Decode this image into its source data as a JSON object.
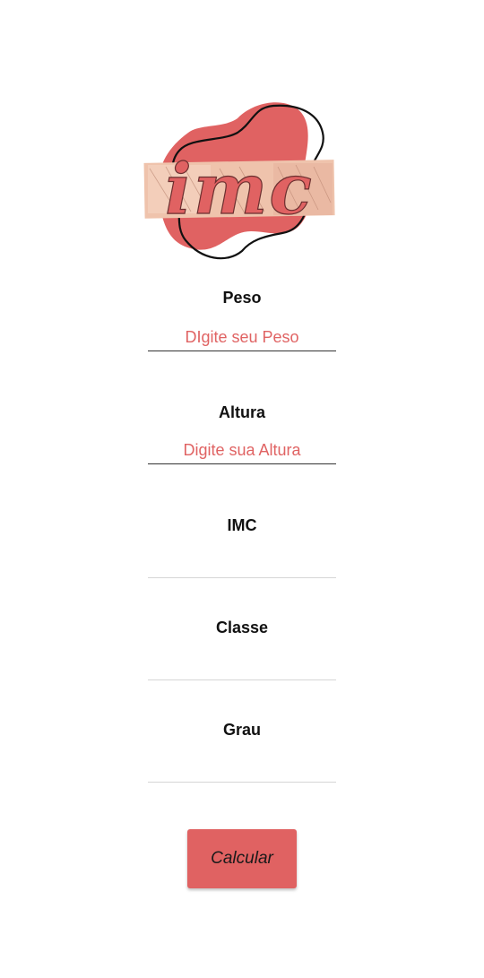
{
  "logo": {
    "text": "imc"
  },
  "form": {
    "peso": {
      "label": "Peso",
      "placeholder": "DIgite seu Peso"
    },
    "altura": {
      "label": "Altura",
      "placeholder": "Digite sua Altura"
    }
  },
  "results": {
    "imc": {
      "label": "IMC"
    },
    "classe": {
      "label": "Classe"
    },
    "grau": {
      "label": "Grau"
    }
  },
  "actions": {
    "calcular_label": "Calcular"
  },
  "colors": {
    "accent": "#e06262",
    "input_text": "#e06363",
    "background": "#ffffff"
  }
}
